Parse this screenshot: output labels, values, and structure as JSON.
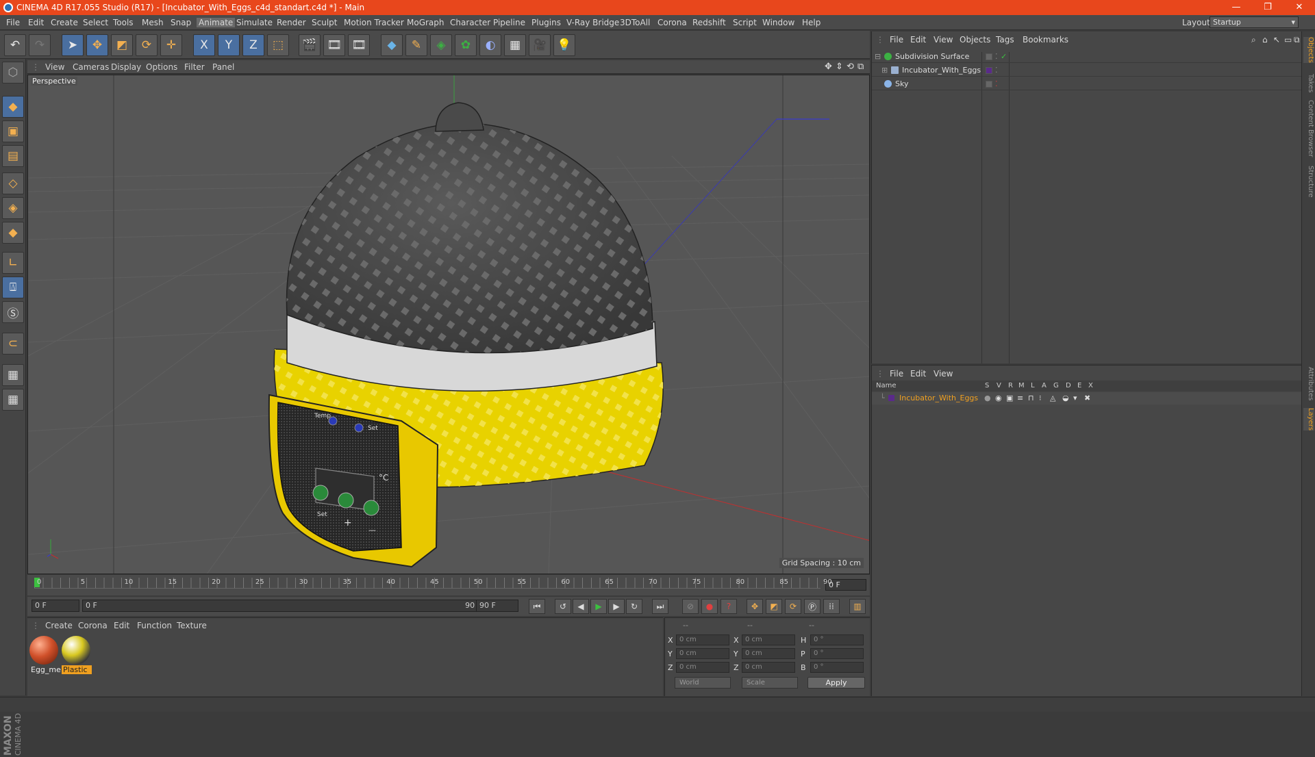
{
  "window": {
    "title": "CINEMA 4D R17.055 Studio (R17) - [Incubator_With_Eggs_c4d_standart.c4d *] - Main",
    "minimize": "—",
    "restore": "❐",
    "close": "✕"
  },
  "menu": {
    "items": [
      "File",
      "Edit",
      "Create",
      "Select",
      "Tools",
      "Mesh",
      "Snap",
      "Animate",
      "Simulate",
      "Render",
      "Sculpt",
      "Motion Tracker",
      "MoGraph",
      "Character",
      "Pipeline",
      "Plugins",
      "V-Ray Bridge",
      "3DToAll",
      "Corona",
      "Redshift",
      "Script",
      "Window",
      "Help"
    ],
    "active": "Animate",
    "layout_label": "Layout:",
    "layout_value": "Startup"
  },
  "toolbar": {
    "undo_icon": "undo-icon",
    "axis_x": "X",
    "axis_y": "Y",
    "axis_z": "Z"
  },
  "viewport": {
    "menu": [
      "View",
      "Cameras",
      "Display",
      "Options",
      "Filter",
      "Panel"
    ],
    "label": "Perspective",
    "grid_spacing": "Grid Spacing : 10 cm",
    "panel_labels": {
      "temp": "Temp",
      "set": "Set",
      "celsius": "°C",
      "plus": "+",
      "minus": "—",
      "set_bottom": "Set"
    },
    "colors": {
      "background": "#565656",
      "dome": "#4a4a4a",
      "base": "#e8d200",
      "band": "#d8d8d8",
      "panel": "#2a2a2a"
    }
  },
  "timeline": {
    "ticks": [
      "0",
      "5",
      "10",
      "15",
      "20",
      "25",
      "30",
      "35",
      "40",
      "45",
      "50",
      "55",
      "60",
      "65",
      "70",
      "75",
      "80",
      "85",
      "90"
    ],
    "frame_display": "0 F"
  },
  "playback": {
    "start_field": "0 F",
    "slider_start": "0 F",
    "slider_end": "90 F",
    "end_field": "90 F"
  },
  "materials": {
    "menu": [
      "Create",
      "Corona",
      "Edit",
      "Function",
      "Texture"
    ],
    "items": [
      {
        "name": "Egg_me",
        "color": "#d0502a",
        "selected": false
      },
      {
        "name": "Plastic",
        "color": "#d8c820",
        "selected": true
      }
    ]
  },
  "coordinates": {
    "headers": [
      "--",
      "--",
      "--"
    ],
    "rows": [
      {
        "a_label": "X",
        "a_val": "0 cm",
        "b_label": "X",
        "b_val": "0 cm",
        "c_label": "H",
        "c_val": "0 °"
      },
      {
        "a_label": "Y",
        "a_val": "0 cm",
        "b_label": "Y",
        "b_val": "0 cm",
        "c_label": "P",
        "c_val": "0 °"
      },
      {
        "a_label": "Z",
        "a_val": "0 cm",
        "b_label": "Z",
        "b_val": "0 cm",
        "c_label": "B",
        "c_val": "0 °"
      }
    ],
    "world_select": "World",
    "scale_select": "Scale",
    "apply_label": "Apply"
  },
  "object_manager": {
    "menu": [
      "File",
      "Edit",
      "View",
      "Objects",
      "Tags",
      "Bookmarks"
    ],
    "objects": [
      {
        "name": "Subdivision Surface",
        "icon_color": "#3cb043"
      },
      {
        "name": "Incubator_With_Eggs",
        "icon_color": "#9ab0d0"
      },
      {
        "name": "Sky",
        "icon_color": "#8ab4e8"
      }
    ]
  },
  "layer_manager": {
    "menu": [
      "File",
      "Edit",
      "View"
    ],
    "columns": [
      "Name",
      "S",
      "V",
      "R",
      "M",
      "L",
      "A",
      "G",
      "D",
      "E",
      "X"
    ],
    "layer": {
      "name": "Incubator_With_Eggs",
      "color": "#5a2a8a"
    }
  },
  "side_tabs": [
    "Objects",
    "Takes",
    "Content Browser",
    "Structure",
    "Attributes",
    "Layers"
  ],
  "brand": {
    "maxon": "MAXON",
    "cinema": "CINEMA 4D"
  }
}
